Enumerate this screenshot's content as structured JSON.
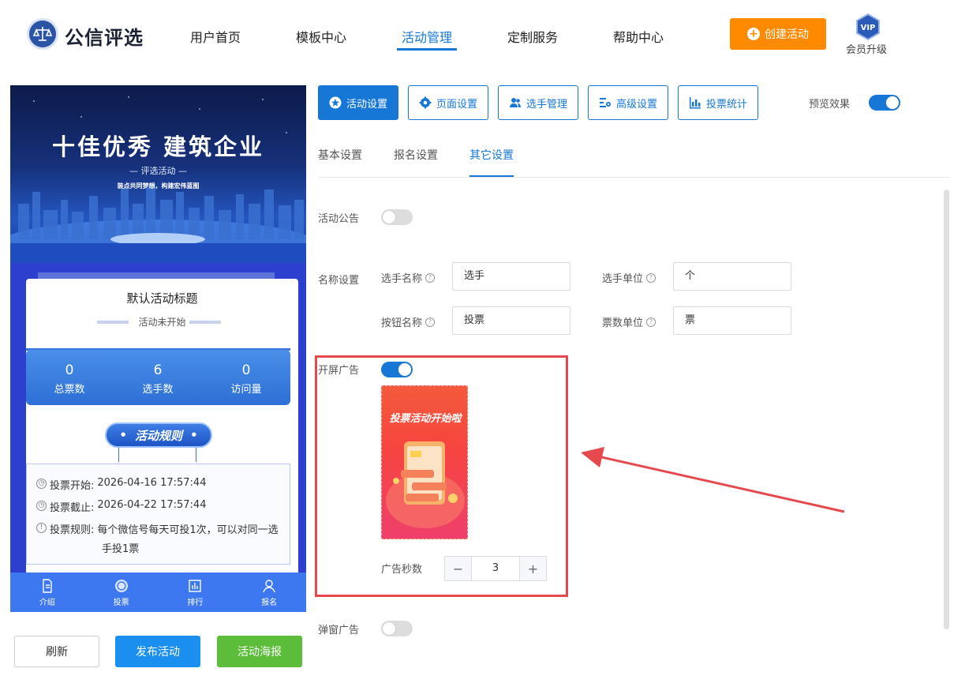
{
  "header": {
    "brand": "公信评选",
    "nav": [
      "用户首页",
      "模板中心",
      "活动管理",
      "定制服务",
      "帮助中心"
    ],
    "active_nav": "活动管理",
    "create_label": "创建活动",
    "vip_badge": "VIP",
    "vip_label": "会员升级"
  },
  "preview": {
    "banner_title": "十佳优秀 建筑企业",
    "banner_sub": "— 评选活动 —",
    "banner_tag": "装点共同梦想，构建宏伟蓝图",
    "activity_title": "默认活动标题",
    "activity_status": "活动未开始",
    "stats": [
      {
        "value": "0",
        "label": "总票数"
      },
      {
        "value": "6",
        "label": "选手数"
      },
      {
        "value": "0",
        "label": "访问量"
      }
    ],
    "rules_title": "活动规则",
    "rules": [
      {
        "label": "投票开始:",
        "value": "2026-04-16 17:57:44"
      },
      {
        "label": "投票截止:",
        "value": "2026-04-22 17:57:44"
      },
      {
        "label": "投票规则:",
        "value": "每个微信号每天可投1次，可以对同一选",
        "value2": "手投1票"
      }
    ],
    "tabs": [
      "介绍",
      "投票",
      "排行",
      "报名"
    ]
  },
  "actions": {
    "refresh": "刷新",
    "publish": "发布活动",
    "poster": "活动海报"
  },
  "settings": {
    "top_tabs": [
      "活动设置",
      "页面设置",
      "选手管理",
      "高级设置",
      "投票统计"
    ],
    "active_top_tab": "活动设置",
    "preview_label": "预览效果",
    "preview_on": true,
    "sub_tabs": [
      "基本设置",
      "报名设置",
      "其它设置"
    ],
    "active_sub_tab": "其它设置",
    "notice_label": "活动公告",
    "notice_on": false,
    "name_settings_label": "名称设置",
    "fields": {
      "player_name": {
        "label": "选手名称",
        "value": "选手"
      },
      "player_unit": {
        "label": "选手单位",
        "value": "个"
      },
      "button_name": {
        "label": "按钮名称",
        "value": "投票"
      },
      "vote_unit": {
        "label": "票数单位",
        "value": "票"
      }
    },
    "splash_ad_label": "开屏广告",
    "splash_ad_on": true,
    "ad_image_text": "投票活动开始啦",
    "ad_seconds_label": "广告秒数",
    "ad_seconds": "3",
    "popup_ad_label": "弹窗广告",
    "popup_ad_on": false
  },
  "colors": {
    "primary": "#1677d6",
    "accent_orange": "#ff8a00",
    "highlight_red": "#e5484d",
    "poster_green": "#5bbd3a"
  }
}
